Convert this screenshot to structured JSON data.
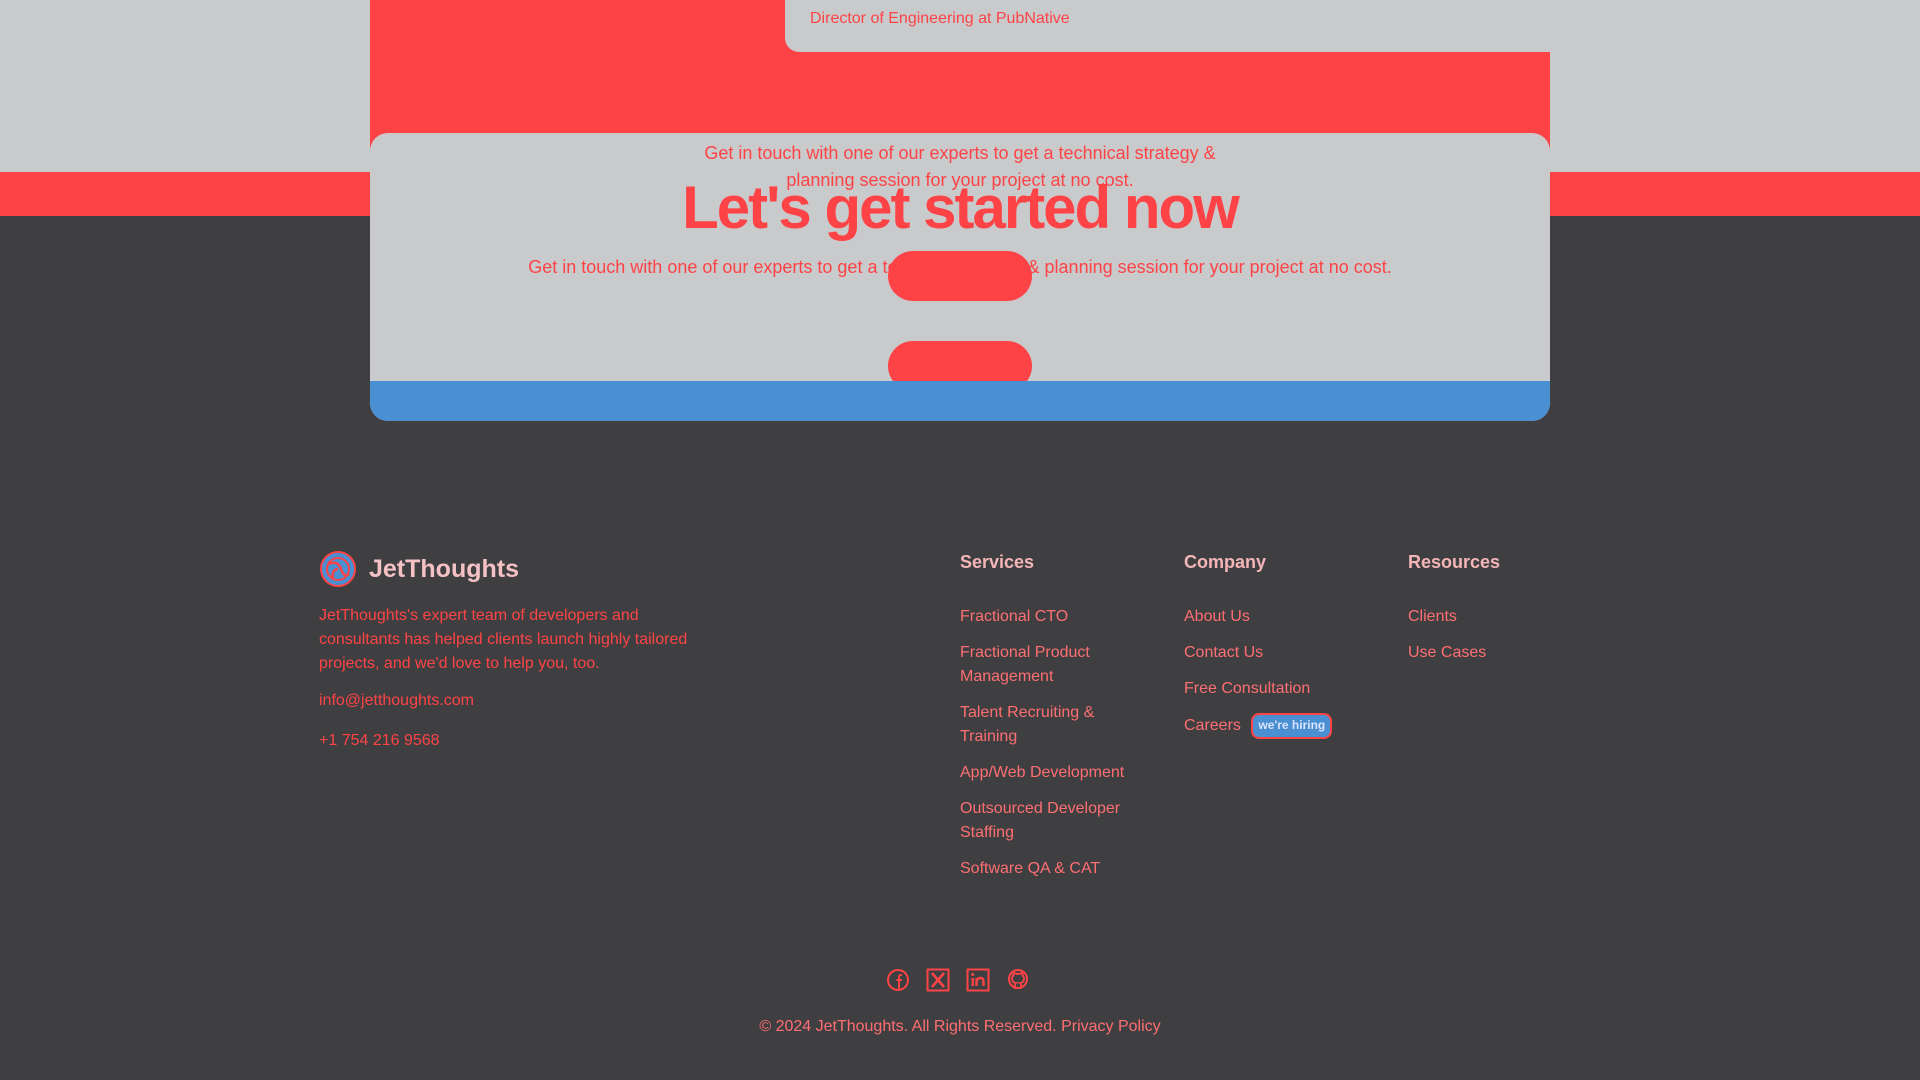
{
  "testimonial": {
    "role": "Director of Engineering at PubNative"
  },
  "cta": {
    "subtitle_small": "Get in touch with one of our experts to get a technical strategy & planning session for your project at no cost.",
    "title": "Let's get started now",
    "subtitle_wide": "Get in touch with one of our experts to get a technical strategy & planning session for your project at no cost.",
    "button_one_label": "",
    "button_two_label": ""
  },
  "footer": {
    "brand_name": "JetThoughts",
    "description": "JetThoughts's expert team of developers and consultants has helped clients launch highly tailored projects, and we'd love to help you, too.",
    "email": "info@jetthoughts.com",
    "phone": "+1 754 216 9568",
    "services": {
      "heading": "Services",
      "items": [
        "Fractional CTO",
        "Fractional Product Management",
        "Talent Recruiting & Training",
        "App/Web Development",
        "Outsourced Developer Staffing",
        "Software QA & CAT"
      ]
    },
    "company": {
      "heading": "Company",
      "items": [
        "About Us",
        "Contact Us",
        "Free Consultation",
        "Careers"
      ],
      "hiring_badge": "we're hiring"
    },
    "resources": {
      "heading": "Resources",
      "items": [
        "Clients",
        "Use Cases"
      ]
    },
    "social_icons": [
      "facebook-icon",
      "x-twitter-icon",
      "linkedin-icon",
      "github-icon"
    ],
    "copyright": "© 2024 JetThoughts. All Rights Reserved.",
    "privacy_link": "Privacy Policy"
  },
  "colors": {
    "accent_red": "#fe4346",
    "light_gray": "#c9cacc",
    "dark_bg": "#3f3f41",
    "blue": "#4a8fd1"
  }
}
